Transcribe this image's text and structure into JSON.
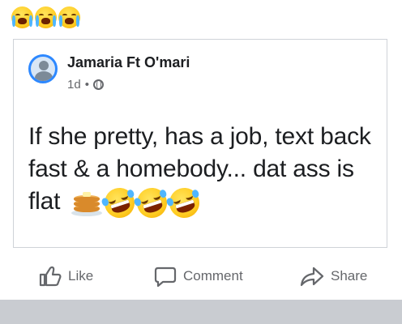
{
  "header_emojis": [
    "loudly-crying-face",
    "loudly-crying-face",
    "loudly-crying-face"
  ],
  "post": {
    "author": "Jamaria Ft O'mari",
    "time": "1d",
    "separator": "•",
    "audience_icon": "globe-icon",
    "text": "If she pretty, has a job, text back fast & a homebody... dat ass is flat",
    "trailing_emojis": [
      "pancakes",
      "face-with-tears-of-joy",
      "face-with-tears-of-joy",
      "face-with-tears-of-joy"
    ]
  },
  "actions": {
    "like": "Like",
    "comment": "Comment",
    "share": "Share"
  },
  "colors": {
    "card_border": "#cfd3d8",
    "muted_text": "#65676b",
    "avatar_ring": "#2d88ff",
    "divider": "#c9ccd1"
  }
}
